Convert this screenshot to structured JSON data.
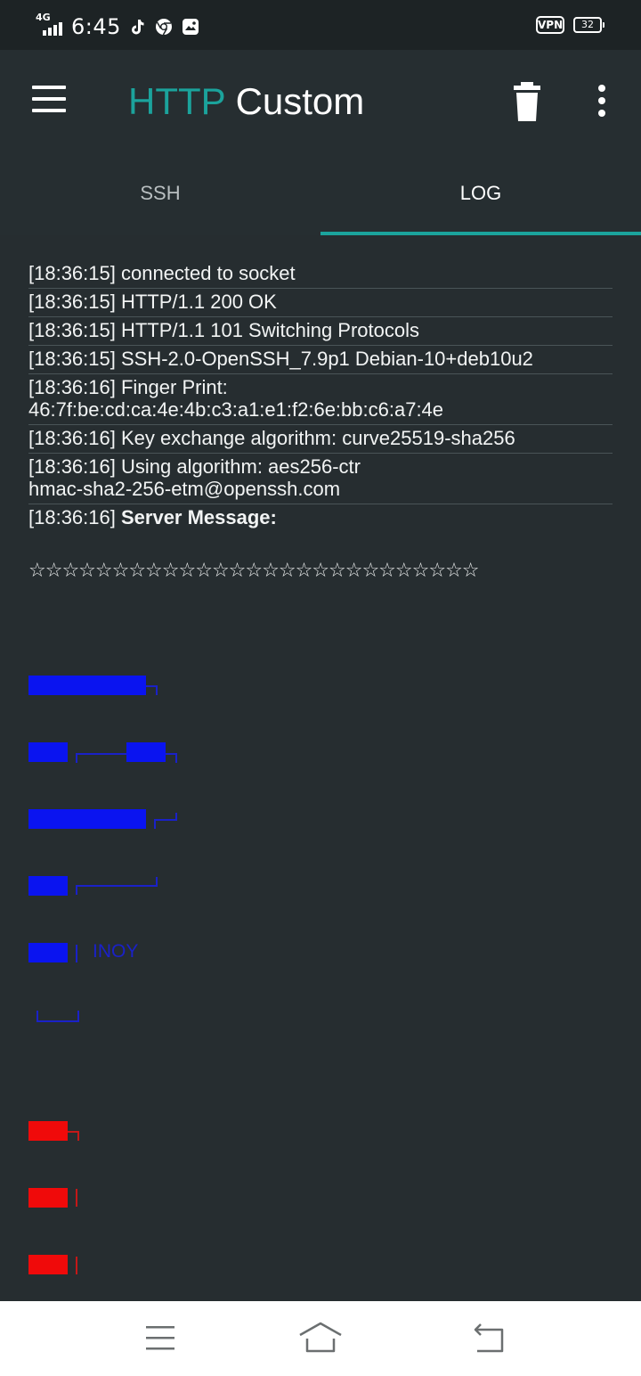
{
  "status_bar": {
    "network_type": "4G",
    "time": "6:45",
    "vpn_label": "VPN",
    "battery_level": "32",
    "notification_icons": [
      "tiktok-icon",
      "chrome-icon",
      "gallery-icon"
    ]
  },
  "app_bar": {
    "title_accent": "HTTP",
    "title_rest": " Custom",
    "accent_color": "#1ba39c",
    "actions": [
      "menu-icon",
      "trash-icon",
      "more-vertical-icon"
    ]
  },
  "tabs": [
    {
      "label": "SSH",
      "active": false
    },
    {
      "label": "LOG",
      "active": true
    }
  ],
  "log": {
    "entries": [
      "[18:36:15] connected to socket",
      "[18:36:15] HTTP/1.1 200 OK",
      "[18:36:15] HTTP/1.1 101 Switching Protocols",
      "[18:36:15] SSH-2.0-OpenSSH_7.9p1 Debian-10+deb10u2",
      "[18:36:16] Finger Print:\n46:7f:be:cd:ca:4e:4b:c3:a1:e1:f2:6e:bb:c6:a7:4e",
      "[18:36:16] Key exchange algorithm: curve25519-sha256",
      "[18:36:16] Using algorithm: aes256-ctr\nhmac-sha2-256-etm@openssh.com"
    ],
    "server_message_prefix": "[18:36:16] ",
    "server_message_label": "Server Message:",
    "stars_line": "☆☆☆☆☆☆☆☆☆☆☆☆☆☆☆☆☆☆☆☆☆☆☆☆☆☆☆",
    "ascii_text": "INOY",
    "ascii_blue": "#0a14f0",
    "ascii_red": "#f00a0a"
  },
  "nav_bar": {
    "buttons": [
      "recents-icon",
      "home-icon",
      "back-icon"
    ]
  }
}
